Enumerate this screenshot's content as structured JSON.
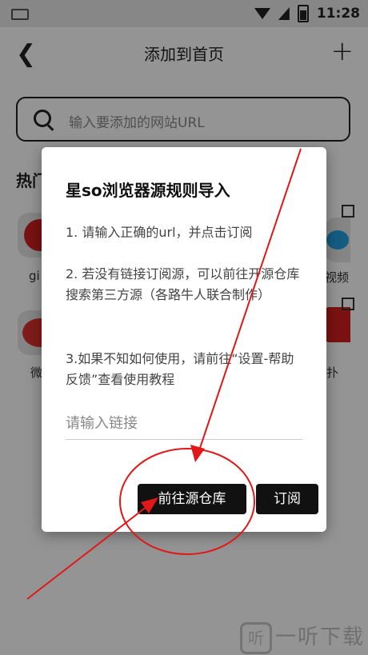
{
  "app_bar": {
    "title": "添加到首页"
  },
  "search": {
    "placeholder": "输入要添加的网站URL"
  },
  "background": {
    "section_heading": "热门",
    "tile_labels": [
      "gi",
      "微",
      "视频",
      "扑"
    ]
  },
  "dialog": {
    "title": "星so浏览器源规则导入",
    "step1": "1. 请输入正确的url，并点击订阅",
    "step2": "2. 若没有链接订阅源，可以前往开源仓库搜索第三方源（各路牛人联合制作）",
    "step3": "3.如果不知如何使用，请前往“设置-帮助反馈”查看使用教程",
    "link_placeholder": "请输入链接",
    "btn_repo": "前往源仓库",
    "btn_subscribe": "订阅"
  },
  "status_bar": {
    "time": "11:28"
  },
  "watermark": {
    "mark": "听",
    "text": "一听下载"
  },
  "colors": {
    "accent": "#111111",
    "annotation": "#e01818"
  },
  "icons": [
    "keyboard-icon",
    "wifi-icon",
    "no-signal-icon",
    "battery-icon",
    "back-arrow-icon",
    "plus-icon",
    "search-icon"
  ]
}
